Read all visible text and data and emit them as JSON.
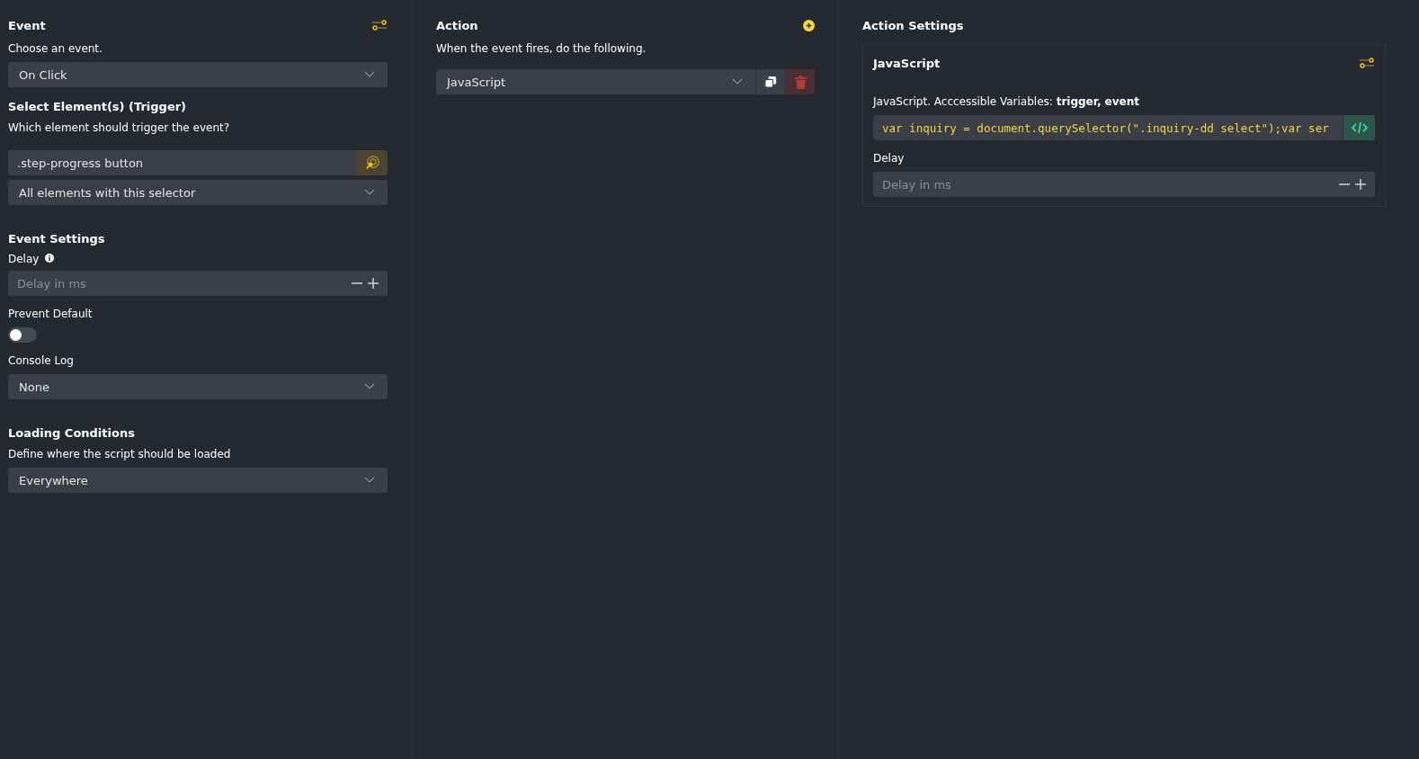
{
  "event_panel": {
    "title": "Event",
    "event_label": "Choose an event.",
    "event_value": "On Click",
    "trigger_title": "Select Element(s) (Trigger)",
    "trigger_label": "Which element should trigger the event?",
    "selector_value": ".step-progress button",
    "scope_value": "All elements with this selector",
    "settings_title": "Event Settings",
    "delay_label": "Delay",
    "delay_placeholder": "Delay in ms",
    "prevent_default": {
      "label": "Prevent Default",
      "on": false
    },
    "console_label": "Console Log",
    "console_value": "None",
    "loading_title": "Loading Conditions",
    "loading_label": "Define where the script should be loaded",
    "loading_value": "Everywhere"
  },
  "action_panel": {
    "title": "Action",
    "subtitle": "When the event fires, do the following.",
    "actions": [
      {
        "value": "JavaScript"
      }
    ]
  },
  "settings_panel": {
    "title": "Action Settings",
    "card_title": "JavaScript",
    "code_label": "JavaScript. Acccessible Variables: **trigger, event**",
    "code_value": "var inquiry = document.querySelector(\".inquiry-dd select\");var ser",
    "delay_label": "Delay",
    "delay_placeholder": "Delay in ms"
  }
}
